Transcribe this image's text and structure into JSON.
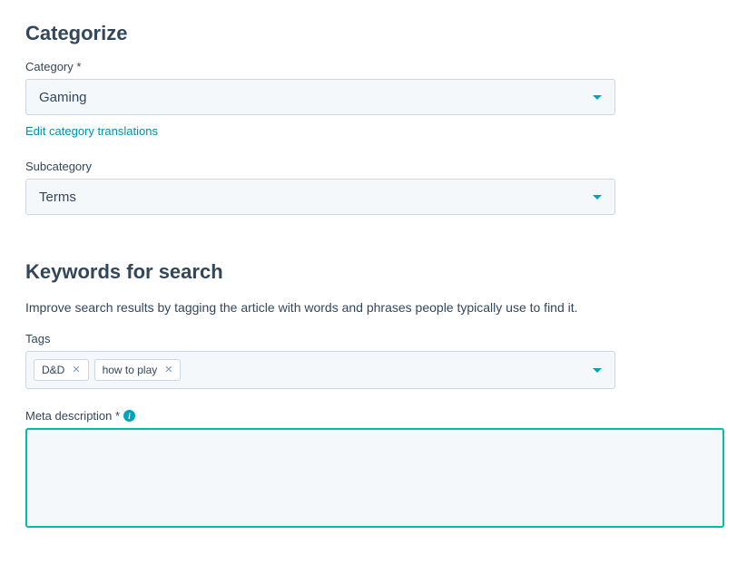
{
  "categorize": {
    "heading": "Categorize",
    "category_label": "Category *",
    "category_value": "Gaming",
    "edit_translations_link": "Edit category translations",
    "subcategory_label": "Subcategory",
    "subcategory_value": "Terms"
  },
  "keywords": {
    "heading": "Keywords for search",
    "description": "Improve search results by tagging the article with words and phrases people typically use to find it.",
    "tags_label": "Tags",
    "tags": [
      "D&D",
      "how to play"
    ],
    "meta_label": "Meta description *",
    "meta_value": ""
  }
}
